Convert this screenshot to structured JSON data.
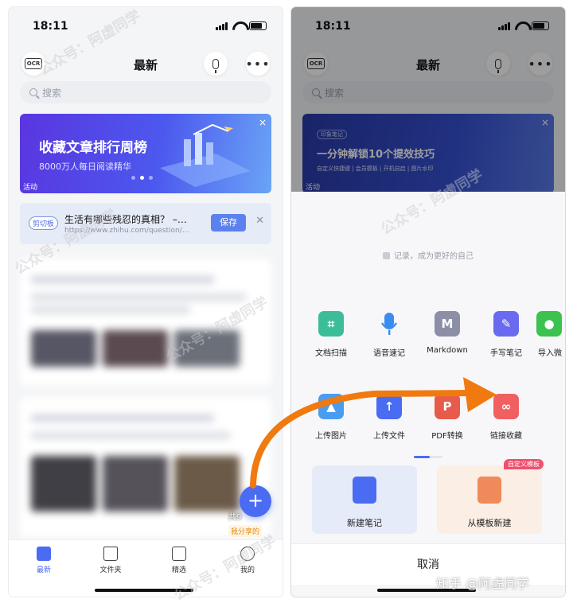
{
  "status_bar": {
    "time": "18:11"
  },
  "left": {
    "nav": {
      "title": "最新",
      "ocr_label": "OCR"
    },
    "search": {
      "placeholder": "搜索"
    },
    "banner": {
      "title": "收藏文章排行周榜",
      "subtitle": "8000万人每日阅读精华",
      "tag": "活动",
      "close": "×"
    },
    "clipboard": {
      "badge": "剪切板",
      "title": "生活有哪些残忍的真相？ –…",
      "url": "https://www.zhihu.com/question/…",
      "save_label": "保存",
      "close": "✕"
    },
    "fab": {
      "label": "+"
    },
    "share_tag": "我分享的",
    "feed_blur_text": "共9",
    "tabs": [
      {
        "label": "最新",
        "icon": "latest-icon",
        "active": true
      },
      {
        "label": "文件夹",
        "icon": "folder-icon",
        "active": false
      },
      {
        "label": "精选",
        "icon": "featured-icon",
        "active": false
      },
      {
        "label": "我的",
        "icon": "profile-icon",
        "active": false
      }
    ]
  },
  "right": {
    "nav": {
      "title": "最新",
      "ocr_label": "OCR"
    },
    "search": {
      "placeholder": "搜索"
    },
    "banner": {
      "title": "一分钟解锁10个提效技巧",
      "badge": "印象笔记",
      "subtitle": "自定义快捷键 | 会员模板 | 开机自启 | 图片水印",
      "tag": "活动",
      "close": "×"
    },
    "sheet": {
      "slogan": "记录，成为更好的自己",
      "tools_row1": [
        {
          "label": "文档扫描",
          "icon": "scan-icon",
          "color": "#3bbd9a"
        },
        {
          "label": "语音速记",
          "icon": "microphone-icon",
          "color": "#3a8df0"
        },
        {
          "label": "Markdown",
          "icon": "markdown-icon",
          "color": "#8c8fa6",
          "glyph": "M"
        },
        {
          "label": "手写笔记",
          "icon": "pen-icon",
          "color": "#6a6af0"
        },
        {
          "label": "导入微",
          "icon": "wechat-icon",
          "color": "#3cc24f"
        }
      ],
      "tools_row2": [
        {
          "label": "上传图片",
          "icon": "image-upload-icon",
          "color": "#4a9cf0"
        },
        {
          "label": "上传文件",
          "icon": "file-upload-icon",
          "color": "#4a6cf2"
        },
        {
          "label": "PDF转换",
          "icon": "pdf-icon",
          "color": "#e85a4a"
        },
        {
          "label": "链接收藏",
          "icon": "link-save-icon",
          "color": "#f06060"
        }
      ],
      "new_note": {
        "label": "新建笔记",
        "icon": "new-note-icon"
      },
      "from_template": {
        "label": "从模板新建",
        "icon": "template-icon",
        "badge": "自定义模板"
      },
      "cancel_label": "取消"
    }
  },
  "watermark_text": "公众号：阿虚同学",
  "credit": "知乎 @阿虚同学",
  "colors": {
    "accent": "#4a6cf2",
    "arrow": "#f07a10"
  }
}
